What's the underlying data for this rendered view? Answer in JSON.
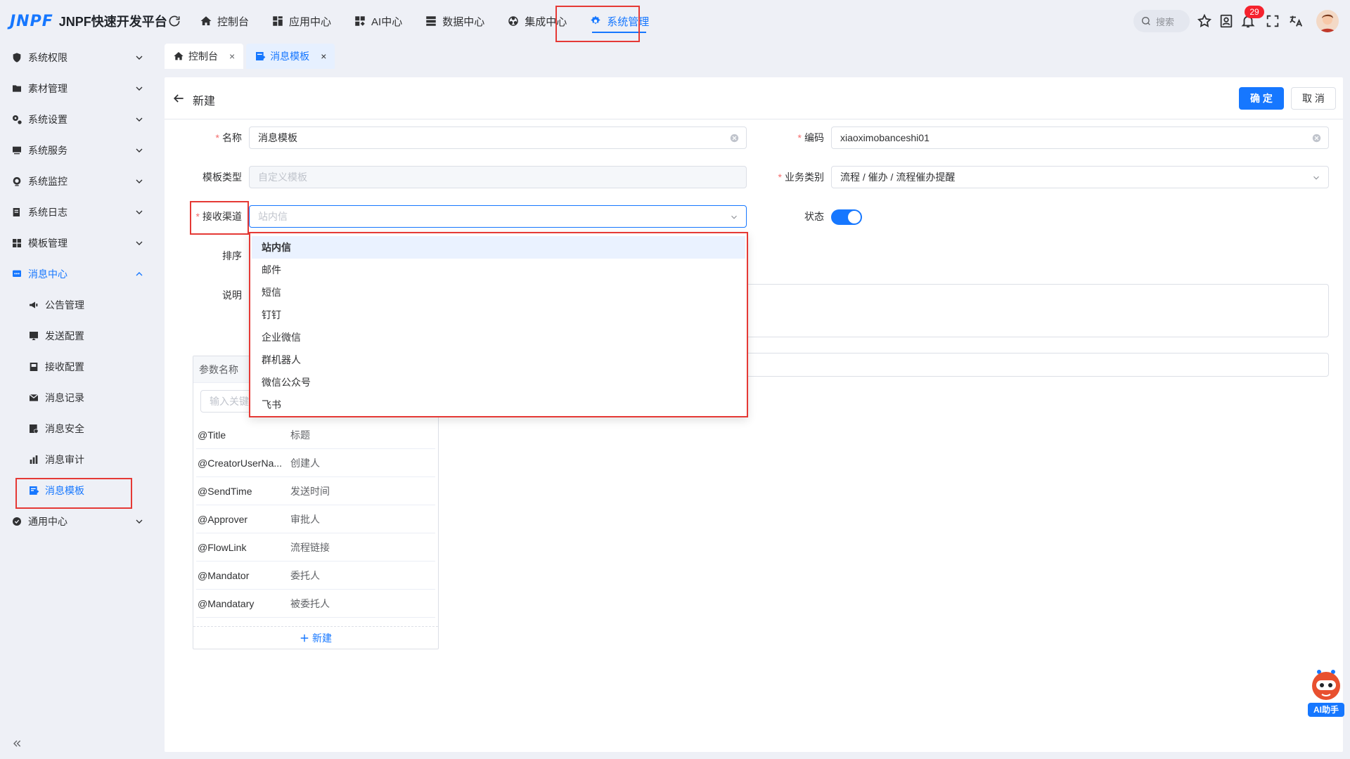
{
  "app": {
    "logo_mark": "JNPF",
    "title": "JNPF快速开发平台"
  },
  "topnav": [
    {
      "label": "控制台",
      "icon": "home-icon"
    },
    {
      "label": "应用中心",
      "icon": "grid-icon"
    },
    {
      "label": "AI中心",
      "icon": "ai-icon"
    },
    {
      "label": "数据中心",
      "icon": "database-icon"
    },
    {
      "label": "集成中心",
      "icon": "integration-icon"
    },
    {
      "label": "系统管理",
      "icon": "gear-icon"
    }
  ],
  "active_topnav": "系统管理",
  "search": {
    "placeholder": "搜索"
  },
  "notifications": {
    "count": "29"
  },
  "sidebar": {
    "items": [
      {
        "label": "系统权限"
      },
      {
        "label": "素材管理"
      },
      {
        "label": "系统设置"
      },
      {
        "label": "系统服务"
      },
      {
        "label": "系统监控"
      },
      {
        "label": "系统日志"
      },
      {
        "label": "模板管理"
      },
      {
        "label": "消息中心"
      },
      {
        "label": "通用中心"
      }
    ],
    "sub_items": [
      {
        "label": "公告管理"
      },
      {
        "label": "发送配置"
      },
      {
        "label": "接收配置"
      },
      {
        "label": "消息记录"
      },
      {
        "label": "消息安全"
      },
      {
        "label": "消息审计"
      },
      {
        "label": "消息模板"
      }
    ]
  },
  "tabs": [
    {
      "label": "控制台",
      "close": "×"
    },
    {
      "label": "消息模板",
      "close": "×"
    }
  ],
  "panel": {
    "title": "新建",
    "confirm_label": "确 定",
    "cancel_label": "取 消"
  },
  "form": {
    "name": {
      "label": "名称",
      "value": "消息模板"
    },
    "code": {
      "label": "编码",
      "value": "xiaoximobanceshi01"
    },
    "template_type": {
      "label": "模板类型",
      "placeholder": "自定义模板"
    },
    "business_category": {
      "label": "业务类别",
      "value": "流程 / 催办 / 流程催办提醒"
    },
    "channel": {
      "label": "接收渠道",
      "placeholder": "站内信"
    },
    "status": {
      "label": "状态",
      "on": true
    },
    "sort": {
      "label": "排序"
    },
    "description": {
      "label": "说明"
    }
  },
  "params": {
    "header": "参数名称",
    "search_placeholder": "输入关键",
    "rows": [
      {
        "key": "@Title",
        "value": "标题"
      },
      {
        "key": "@CreatorUserNa...",
        "value": "创建人"
      },
      {
        "key": "@SendTime",
        "value": "发送时间"
      },
      {
        "key": "@Approver",
        "value": "审批人"
      },
      {
        "key": "@FlowLink",
        "value": "流程链接"
      },
      {
        "key": "@Mandator",
        "value": "委托人"
      },
      {
        "key": "@Mandatary",
        "value": "被委托人"
      }
    ],
    "add_label": "新建"
  },
  "channel_options": [
    {
      "label": "站内信"
    },
    {
      "label": "邮件"
    },
    {
      "label": "短信"
    },
    {
      "label": "钉钉"
    },
    {
      "label": "企业微信"
    },
    {
      "label": "群机器人"
    },
    {
      "label": "微信公众号"
    },
    {
      "label": "飞书"
    }
  ],
  "ai_helper": {
    "label": "AI助手"
  },
  "colors": {
    "primary": "#1677ff",
    "highlight": "#e53935",
    "danger": "#f5222d",
    "background": "#eef0f6"
  }
}
